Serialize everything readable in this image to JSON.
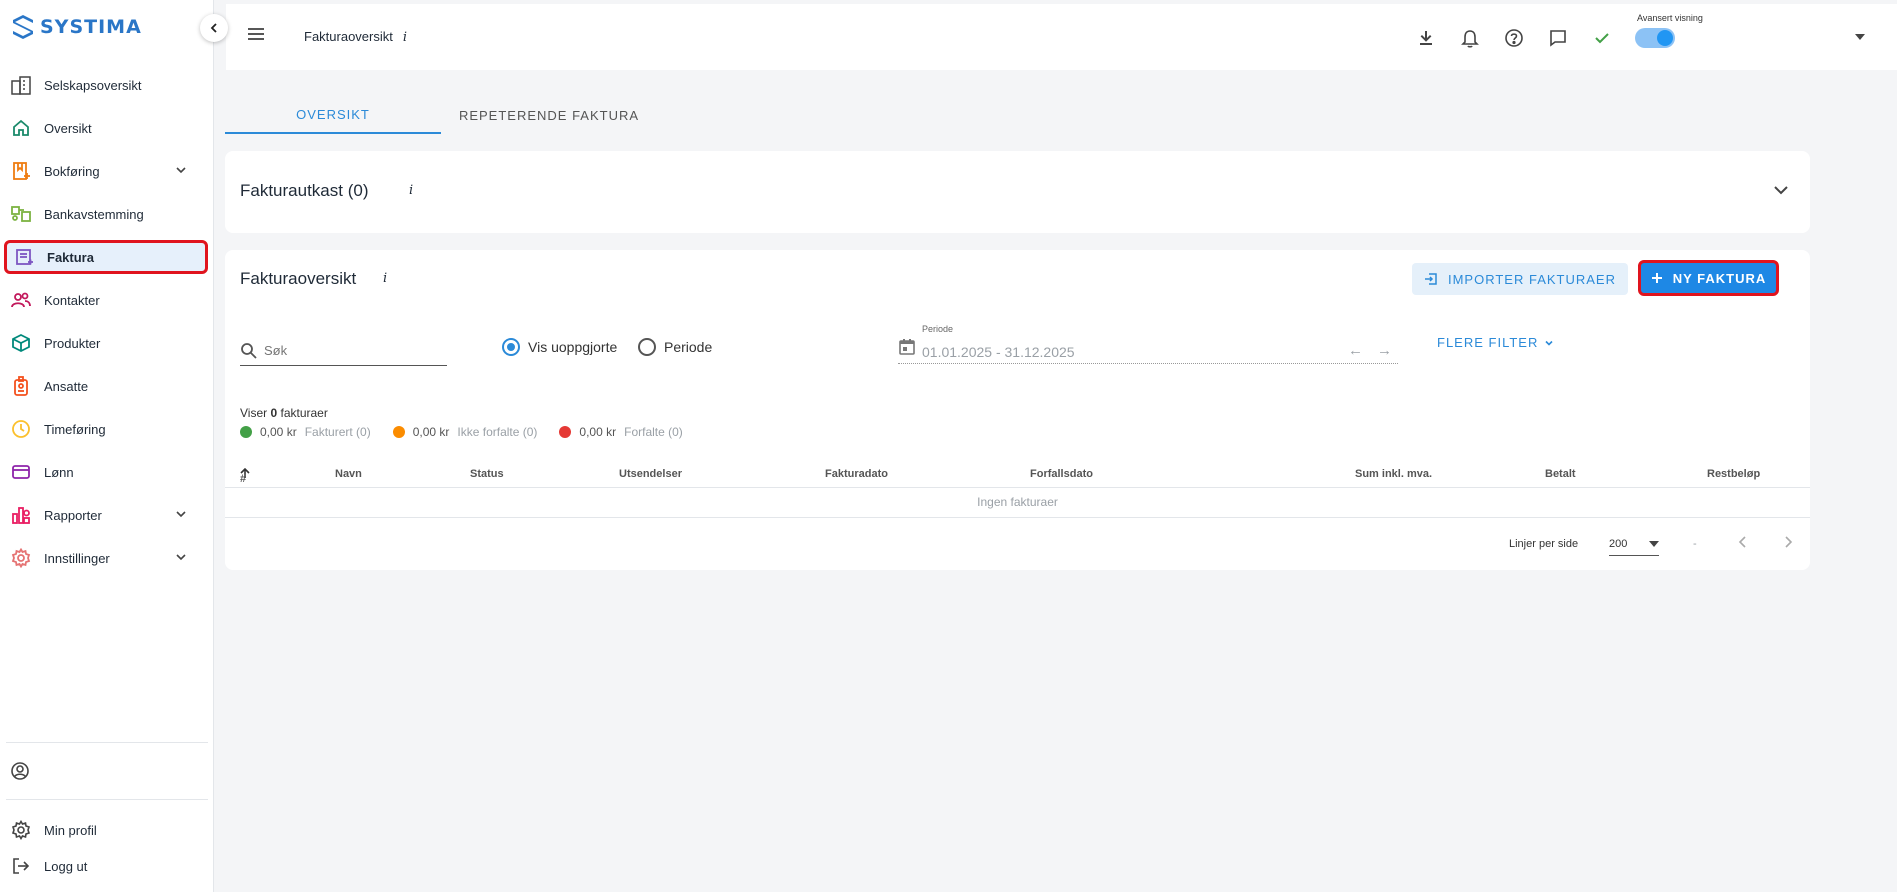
{
  "app": {
    "name": "SYSTIMA"
  },
  "sidebar": {
    "items": [
      {
        "label": "Selskapsoversikt"
      },
      {
        "label": "Oversikt"
      },
      {
        "label": "Bokføring"
      },
      {
        "label": "Bankavstemming"
      },
      {
        "label": "Faktura"
      },
      {
        "label": "Kontakter"
      },
      {
        "label": "Produkter"
      },
      {
        "label": "Ansatte"
      },
      {
        "label": "Timeføring"
      },
      {
        "label": "Lønn"
      },
      {
        "label": "Rapporter"
      },
      {
        "label": "Innstillinger"
      }
    ],
    "bottom": {
      "profile": "Min profil",
      "logout": "Logg ut"
    }
  },
  "topbar": {
    "title": "Fakturaoversikt",
    "info": "i",
    "advanced_label": "Avansert visning"
  },
  "tabs": [
    {
      "label": "OVERSIKT"
    },
    {
      "label": "REPETERENDE FAKTURA"
    }
  ],
  "drafts": {
    "title": "Fakturautkast (0)",
    "info": "i"
  },
  "overview": {
    "title": "Fakturaoversikt",
    "info": "i",
    "import_label": "IMPORTER FAKTURAER",
    "new_label": "NY FAKTURA",
    "search_placeholder": "Søk",
    "radio_unsettled": "Vis uoppgjorte",
    "radio_period": "Periode",
    "period_label": "Periode",
    "period_value": "01.01.2025 - 31.12.2025",
    "more_filter": "FLERE FILTER",
    "count_prefix": "Viser",
    "count_value": "0",
    "count_suffix": "fakturaer",
    "legend": [
      {
        "amount": "0,00 kr",
        "label": "Fakturert (0)",
        "color": "#43a047"
      },
      {
        "amount": "0,00 kr",
        "label": "Ikke forfalte (0)",
        "color": "#fb8c00"
      },
      {
        "amount": "0,00 kr",
        "label": "Forfalte (0)",
        "color": "#e53935"
      }
    ],
    "columns": [
      "#",
      "Navn",
      "Status",
      "Utsendelser",
      "Fakturadato",
      "Forfallsdato",
      "Sum inkl. mva.",
      "Betalt",
      "Restbeløp"
    ],
    "empty_text": "Ingen fakturaer",
    "rows_per_page_label": "Linjer per side",
    "rows_per_page_value": "200",
    "range_text": "-"
  },
  "colors": {
    "accent": "#2b8ad8",
    "primary_button": "#1e88e5",
    "highlight": "#e0141e"
  }
}
